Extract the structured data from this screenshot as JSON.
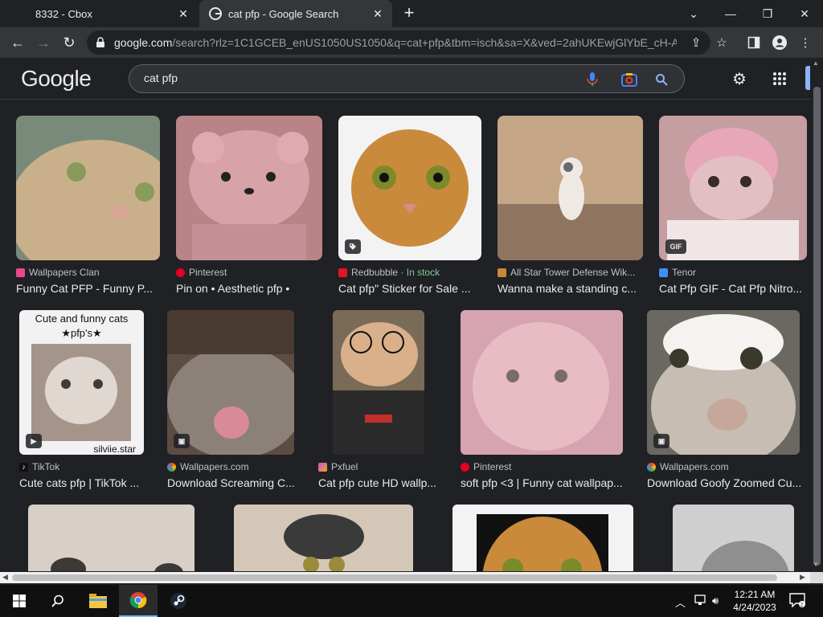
{
  "browser": {
    "tabs": [
      {
        "label": "8332 - Cbox",
        "active": false
      },
      {
        "label": "cat pfp - Google Search",
        "active": true
      }
    ],
    "url_host": "google.com",
    "url_path": "/search?rlz=1C1GCEB_enUS1050US1050&q=cat+pfp&tbm=isch&sa=X&ved=2ahUKEwjGlYbE_cH-A..."
  },
  "google": {
    "logo": "Google",
    "query": "cat pfp"
  },
  "results": [
    {
      "source": "Wallpapers Clan",
      "title": "Funny Cat PFP - Funny P...",
      "icon_color": "#e8478b",
      "img": "#c9b08a",
      "img2": "#7a8a7a"
    },
    {
      "source": "Pinterest",
      "title": "Pin on • Aesthetic pfp •",
      "icon_color": "#e60023",
      "img": "#d7a2a8",
      "img2": "#b98388"
    },
    {
      "source": "Redbubble",
      "stock": "· In stock",
      "title": "Cat pfp\" Sticker for Sale ...",
      "icon_color": "#e41321",
      "img": "#c98a3c",
      "img2": "#f3f3f3",
      "badge": "tag"
    },
    {
      "source": "All Star Tower Defense Wik...",
      "title": "Wanna make a standing c...",
      "icon_color": "#c58a3a",
      "img": "#c4a686",
      "img2": "#8f7560"
    },
    {
      "source": "Tenor",
      "title": "Cat Pfp GIF - Cat Pfp Nitro...",
      "icon_color": "#3d8ff2",
      "img": "#e2bfc2",
      "img2": "#c59ea2",
      "badge": "GIF"
    },
    {
      "source": "TikTok",
      "title": "Cute cats pfp | TikTok ...",
      "icon_color": "#ffffff",
      "img": "#a5948a",
      "img2": "#f2f2f2",
      "badge": "video",
      "caption1": "Cute and funny cats",
      "caption2": "★pfp's★",
      "caption3": "silviie.star"
    },
    {
      "source": "Wallpapers.com",
      "title": "Download Screaming C...",
      "icon_color": "#4caf50",
      "img": "#8c8179",
      "img2": "#5d4c42",
      "badge": "image"
    },
    {
      "source": "Pxfuel",
      "title": "Cat pfp cute HD wallp...",
      "icon_color": "#c94fd6",
      "img": "#d9b08a",
      "img2": "#2b2b2b"
    },
    {
      "source": "Pinterest",
      "title": "soft pfp <3 | Funny cat wallpap...",
      "icon_color": "#e60023",
      "img": "#e8bcc4",
      "img2": "#d6a4b0"
    },
    {
      "source": "Wallpapers.com",
      "title": "Download Goofy Zoomed Cu...",
      "icon_color": "#4caf50",
      "img": "#c8bdb3",
      "img2": "#6b6862",
      "badge": "image"
    },
    {
      "img": "#d8cfc6",
      "img2": "#9e9286"
    },
    {
      "img": "#d5c7b8",
      "img2": "#3a3a3a"
    },
    {
      "img": "#c98a3c",
      "img2": "#111111"
    },
    {
      "img": "#cfcfcf",
      "img2": "#8f8f8f"
    }
  ],
  "taskbar": {
    "time": "12:21 AM",
    "date": "4/24/2023"
  }
}
